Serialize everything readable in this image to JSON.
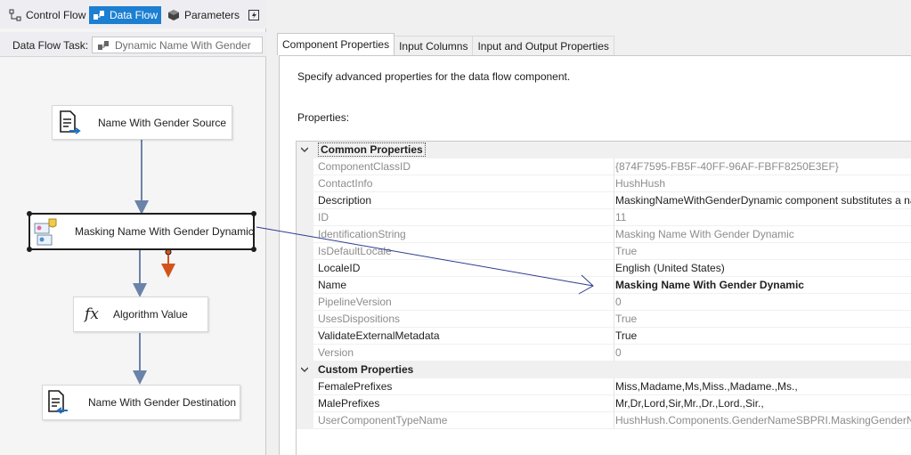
{
  "designer": {
    "tabs": [
      {
        "label": "Control Flow",
        "icon": "control-flow-icon",
        "active": false
      },
      {
        "label": "Data Flow",
        "icon": "data-flow-icon",
        "active": true
      },
      {
        "label": "Parameters",
        "icon": "parameters-icon",
        "active": false
      }
    ],
    "task_label": "Data Flow Task:",
    "task_value": "Dynamic Name With Gender",
    "components": {
      "source": "Name With Gender Source",
      "masking": "Masking Name With Gender Dynamic",
      "algorithm": "Algorithm Value",
      "destination": "Name With Gender Destination"
    }
  },
  "properties_editor": {
    "tabs": [
      "Component Properties",
      "Input Columns",
      "Input and Output Properties"
    ],
    "active_tab": "Component Properties",
    "description": "Specify advanced properties for the data flow component.",
    "properties_label": "Properties:",
    "categories": [
      {
        "name": "Common Properties",
        "rows": [
          {
            "name": "ComponentClassID",
            "value": "{874F7595-FB5F-40FF-96AF-FBFF8250E3EF}",
            "readonly": true
          },
          {
            "name": "ContactInfo",
            "value": "HushHush",
            "readonly": true
          },
          {
            "name": "Description",
            "value": "MaskingNameWithGenderDynamic component substitutes a na",
            "readonly": false
          },
          {
            "name": "ID",
            "value": "11",
            "readonly": true
          },
          {
            "name": "IdentificationString",
            "value": "Masking Name With Gender Dynamic",
            "readonly": true
          },
          {
            "name": "IsDefaultLocale",
            "value": "True",
            "readonly": true
          },
          {
            "name": "LocaleID",
            "value": "English (United States)",
            "readonly": false
          },
          {
            "name": "Name",
            "value": "Masking Name With Gender Dynamic",
            "readonly": false,
            "bold": true
          },
          {
            "name": "PipelineVersion",
            "value": "0",
            "readonly": true
          },
          {
            "name": "UsesDispositions",
            "value": "True",
            "readonly": true
          },
          {
            "name": "ValidateExternalMetadata",
            "value": "True",
            "readonly": false
          },
          {
            "name": "Version",
            "value": "0",
            "readonly": true
          }
        ]
      },
      {
        "name": "Custom Properties",
        "rows": [
          {
            "name": "FemalePrefixes",
            "value": "Miss,Madame,Ms,Miss.,Madame.,Ms.,",
            "readonly": false
          },
          {
            "name": "MalePrefixes",
            "value": "Mr,Dr,Lord,Sir,Mr.,Dr.,Lord.,Sir.,",
            "readonly": false
          },
          {
            "name": "UserComponentTypeName",
            "value": "HushHush.Components.GenderNameSBPRI.MaskingGenderNar",
            "readonly": true
          }
        ]
      }
    ]
  },
  "colors": {
    "accent": "#1c7fd1",
    "connector": "#6b83a9",
    "error_output": "#d4531c",
    "callout_arrow": "#2b3d8f"
  }
}
